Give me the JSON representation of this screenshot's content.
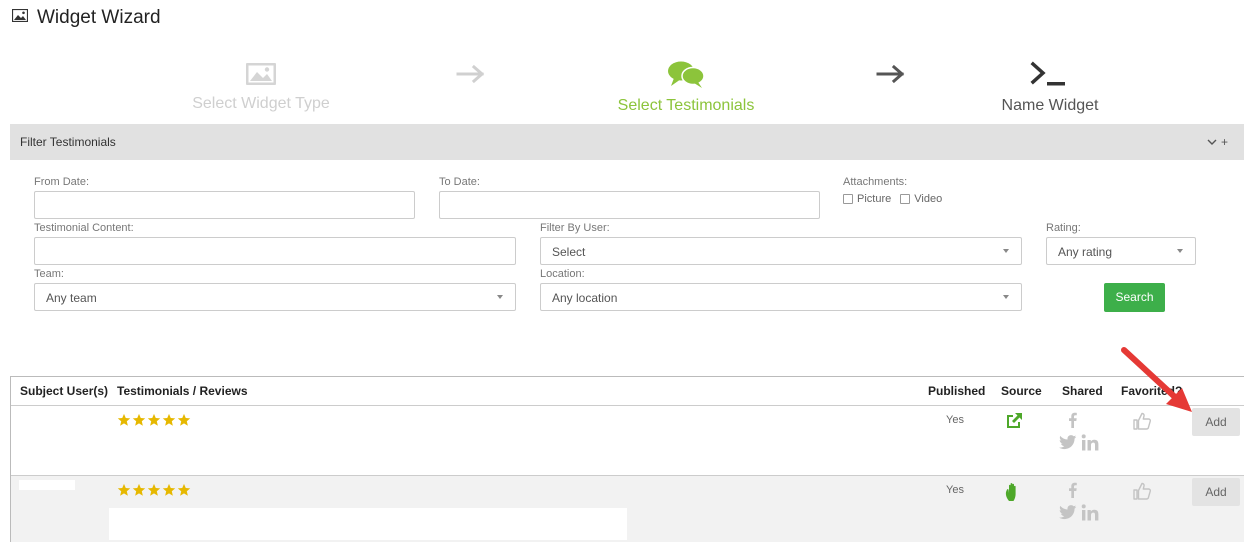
{
  "header": {
    "title": "Widget Wizard",
    "icon": "image-icon"
  },
  "wizard": {
    "steps": [
      {
        "label": "Select Widget Type",
        "icon": "image-icon",
        "state": "done"
      },
      {
        "label": "Select Testimonials",
        "icon": "chat-bubbles-icon",
        "state": "active"
      },
      {
        "label": "Name Widget",
        "icon": "terminal-prompt-icon",
        "state": "pending"
      }
    ]
  },
  "filter": {
    "title": "Filter Testimonials",
    "from_date_label": "From Date:",
    "from_date_value": "",
    "to_date_label": "To Date:",
    "to_date_value": "",
    "attachments_label": "Attachments:",
    "picture_label": "Picture",
    "video_label": "Video",
    "content_label": "Testimonial Content:",
    "content_value": "",
    "user_label": "Filter By User:",
    "user_value": "Select",
    "rating_label": "Rating:",
    "rating_value": "Any rating",
    "team_label": "Team:",
    "team_value": "Any team",
    "location_label": "Location:",
    "location_value": "Any location",
    "search_label": "Search"
  },
  "table": {
    "columns": [
      "Subject User(s)",
      "Testimonials / Reviews",
      "Published",
      "Source",
      "Shared",
      "Favorited?"
    ],
    "rows": [
      {
        "rating": 5,
        "published": "Yes",
        "source_icon": "external-link-icon",
        "add_label": "Add"
      },
      {
        "rating": 5,
        "published": "Yes",
        "source_icon": "hand-icon",
        "add_label": "Add"
      }
    ]
  },
  "colors": {
    "accent_green": "#8cc43b",
    "search_green": "#3daf4a",
    "star_gold": "#e6b800",
    "callout_red": "#e53935"
  }
}
